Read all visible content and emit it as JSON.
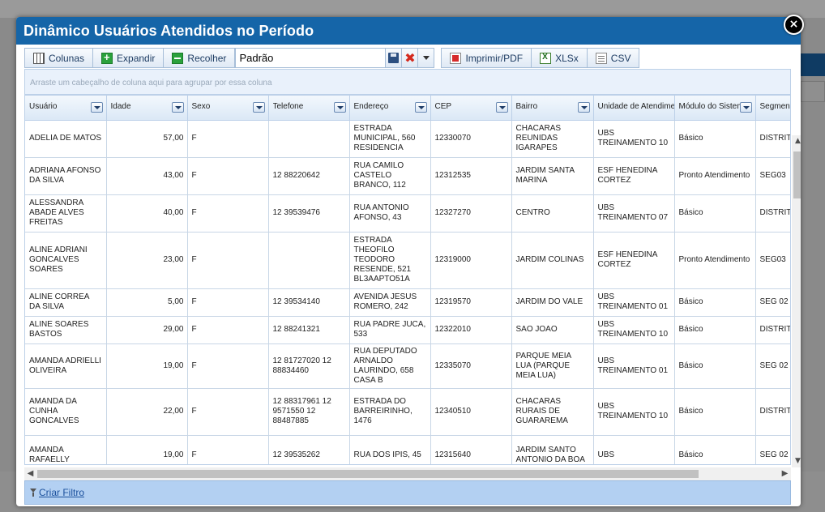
{
  "dialog": {
    "title": "Dinâmico Usuários Atendidos no Período",
    "close_label": "×"
  },
  "toolbar": {
    "columns_label": "Colunas",
    "expand_label": "Expandir",
    "collapse_label": "Recolher",
    "layout_value": "Padrão",
    "pdf_label": "Imprimir/PDF",
    "xlsx_label": "XLSx",
    "csv_label": "CSV"
  },
  "group_panel": {
    "hint": "Arraste um cabeçalho de coluna aqui para agrupar por essa coluna"
  },
  "grid": {
    "columns": [
      "Usuário",
      "Idade",
      "Sexo",
      "Telefone",
      "Endereço",
      "CEP",
      "Bairro",
      "Unidade de Atendimento",
      "Módulo do Sistema",
      "Segmento"
    ],
    "rows": [
      {
        "usuario": "ADELIA DE MATOS",
        "idade": "57,00",
        "sexo": "F",
        "telefone": "",
        "endereco": "ESTRADA MUNICIPAL, 560 RESIDENCIA",
        "cep": "12330070",
        "bairro": "CHACARAS REUNIDAS IGARAPES",
        "unidade": "UBS TREINAMENTO 10",
        "modulo": "Básico",
        "segmento": "DISTRITO CENTRO"
      },
      {
        "usuario": "ADRIANA AFONSO DA SILVA",
        "idade": "43,00",
        "sexo": "F",
        "telefone": "12 88220642",
        "endereco": "RUA CAMILO CASTELO BRANCO, 112",
        "cep": "12312535",
        "bairro": "JARDIM SANTA MARINA",
        "unidade": "ESF HENEDINA CORTEZ",
        "modulo": "Pronto Atendimento",
        "segmento": "SEG03"
      },
      {
        "usuario": "ALESSANDRA ABADE ALVES FREITAS",
        "idade": "40,00",
        "sexo": "F",
        "telefone": "12 39539476",
        "endereco": "RUA ANTONIO AFONSO, 43",
        "cep": "12327270",
        "bairro": "CENTRO",
        "unidade": "UBS TREINAMENTO 07",
        "modulo": "Básico",
        "segmento": "DISTRITO CENTRO"
      },
      {
        "usuario": "ALINE ADRIANI GONCALVES SOARES",
        "idade": "23,00",
        "sexo": "F",
        "telefone": "",
        "endereco": "ESTRADA THEOFILO TEODORO RESENDE, 521 BL3AAPTO51A",
        "cep": "12319000",
        "bairro": "JARDIM COLINAS",
        "unidade": "ESF HENEDINA CORTEZ",
        "modulo": "Pronto Atendimento",
        "segmento": "SEG03"
      },
      {
        "usuario": "ALINE CORREA DA SILVA",
        "idade": "5,00",
        "sexo": "F",
        "telefone": "12 39534140",
        "endereco": "AVENIDA JESUS ROMERO, 242",
        "cep": "12319570",
        "bairro": "JARDIM DO VALE",
        "unidade": "UBS TREINAMENTO 01",
        "modulo": "Básico",
        "segmento": "SEG 02"
      },
      {
        "usuario": "ALINE SOARES BASTOS",
        "idade": "29,00",
        "sexo": "F",
        "telefone": "12 88241321",
        "endereco": "RUA PADRE JUCA, 533",
        "cep": "12322010",
        "bairro": "SAO JOAO",
        "unidade": "UBS TREINAMENTO 10",
        "modulo": "Básico",
        "segmento": "DISTRITO CENTRO"
      },
      {
        "usuario": "AMANDA ADRIELLI OLIVEIRA",
        "idade": "19,00",
        "sexo": "F",
        "telefone": "12 81727020 12 88834460",
        "endereco": "RUA DEPUTADO ARNALDO LAURINDO, 658 CASA B",
        "cep": "12335070",
        "bairro": "PARQUE MEIA LUA (PARQUE MEIA LUA)",
        "unidade": "UBS TREINAMENTO 01",
        "modulo": "Básico",
        "segmento": "SEG 02"
      },
      {
        "usuario": "AMANDA DA CUNHA GONCALVES",
        "idade": "22,00",
        "sexo": "F",
        "telefone": "12 88317961 12 9571550 12 88487885",
        "endereco": "ESTRADA DO BARREIRINHO, 1476",
        "cep": "12340510",
        "bairro": "CHACARAS RURAIS DE GUARAREMA",
        "unidade": "UBS TREINAMENTO 10",
        "modulo": "Básico",
        "segmento": "DISTRITO CENTRO"
      },
      {
        "usuario": "AMANDA RAFAELLY",
        "idade": "19,00",
        "sexo": "F",
        "telefone": "12 39535262",
        "endereco": "RUA DOS IPIS, 45",
        "cep": "12315640",
        "bairro": "JARDIM SANTO ANTONIO DA BOA",
        "unidade": "UBS",
        "modulo": "Básico",
        "segmento": "SEG 02"
      }
    ]
  },
  "footer": {
    "create_filter_label": "Criar Filtro"
  },
  "colors": {
    "header_blue": "#1565a8",
    "filter_bar": "#b3d0f2"
  }
}
